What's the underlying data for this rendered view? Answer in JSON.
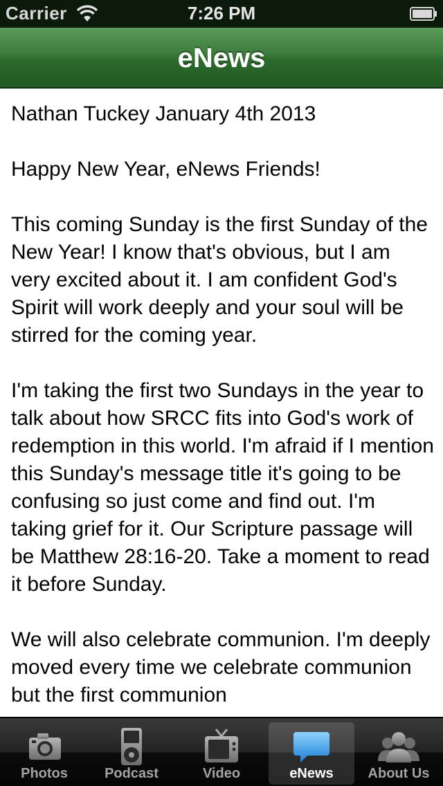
{
  "status_bar": {
    "carrier": "Carrier",
    "time": "7:26 PM"
  },
  "nav": {
    "title": "eNews"
  },
  "article": {
    "paragraphs": [
      "Nathan Tuckey January 4th 2013",
      "Happy New Year, eNews Friends!",
      "This coming Sunday is the first Sunday of the New Year! I know that's obvious, but I am very excited about it. I am confident God's Spirit will work deeply and your soul will be stirred for the coming year.",
      "I'm taking the first two Sundays in the year to talk about how SRCC fits into God's work of redemption in this world. I'm afraid if I mention this Sunday's message title it's going to be confusing so just come and find out. I'm taking grief for it. Our Scripture passage will be Matthew 28:16-20. Take a moment to read it before Sunday.",
      "We will also celebrate communion. I'm deeply moved every time we celebrate communion but the first communion"
    ]
  },
  "tabs": [
    {
      "label": "Photos",
      "icon": "camera-icon",
      "active": false
    },
    {
      "label": "Podcast",
      "icon": "ipod-icon",
      "active": false
    },
    {
      "label": "Video",
      "icon": "tv-icon",
      "active": false
    },
    {
      "label": "eNews",
      "icon": "speech-bubble-icon",
      "active": true
    },
    {
      "label": "About Us",
      "icon": "people-icon",
      "active": false
    }
  ],
  "colors": {
    "nav_green": "#2d6a2d",
    "active_tab_icon": "#3ba6ee"
  }
}
